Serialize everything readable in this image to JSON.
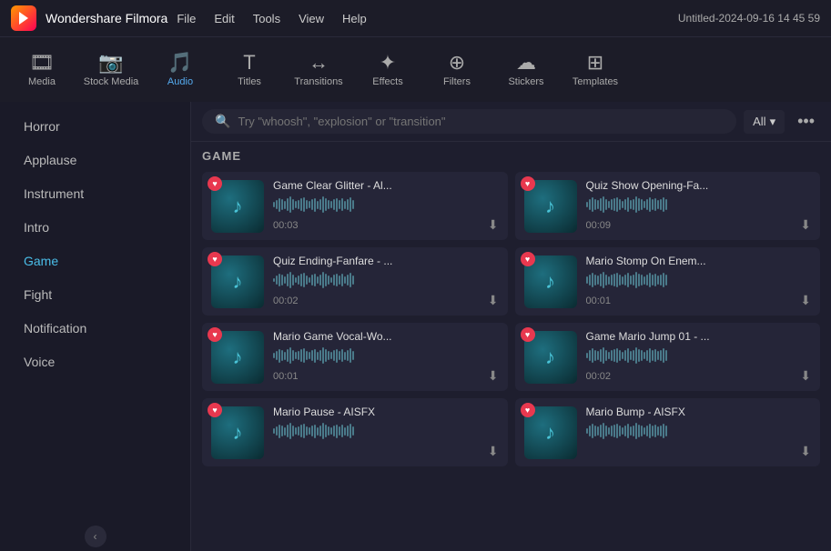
{
  "app": {
    "name": "Wondershare Filmora",
    "title": "Untitled-2024-09-16 14 45 59"
  },
  "menu": {
    "items": [
      "File",
      "Edit",
      "Tools",
      "View",
      "Help"
    ]
  },
  "toolbar": {
    "items": [
      {
        "id": "media",
        "icon": "🎞",
        "label": "Media",
        "active": false
      },
      {
        "id": "stock-media",
        "icon": "📷",
        "label": "Stock Media",
        "active": false
      },
      {
        "id": "audio",
        "icon": "🎵",
        "label": "Audio",
        "active": true
      },
      {
        "id": "titles",
        "icon": "T",
        "label": "Titles",
        "active": false
      },
      {
        "id": "transitions",
        "icon": "↔",
        "label": "Transitions",
        "active": false
      },
      {
        "id": "effects",
        "icon": "✦",
        "label": "Effects",
        "active": false
      },
      {
        "id": "filters",
        "icon": "⊕",
        "label": "Filters",
        "active": false
      },
      {
        "id": "stickers",
        "icon": "☁",
        "label": "Stickers",
        "active": false
      },
      {
        "id": "templates",
        "icon": "⊞",
        "label": "Templates",
        "active": false
      }
    ]
  },
  "sidebar": {
    "items": [
      {
        "label": "Horror",
        "active": false
      },
      {
        "label": "Applause",
        "active": false
      },
      {
        "label": "Instrument",
        "active": false
      },
      {
        "label": "Intro",
        "active": false
      },
      {
        "label": "Game",
        "active": true
      },
      {
        "label": "Fight",
        "active": false
      },
      {
        "label": "Notification",
        "active": false
      },
      {
        "label": "Voice",
        "active": false
      },
      {
        "label": "...",
        "active": false
      }
    ],
    "collapse_btn": "‹"
  },
  "search": {
    "placeholder": "Try \"whoosh\", \"explosion\" or \"transition\"",
    "filter_label": "All",
    "more_icon": "•••"
  },
  "section": {
    "title": "GAME"
  },
  "audio_cards": [
    {
      "name": "Game Clear Glitter - Al...",
      "duration": "00:03",
      "waveform_bars": [
        4,
        7,
        10,
        8,
        6,
        9,
        12,
        8,
        5,
        7,
        9,
        11,
        7,
        5,
        8,
        10,
        6,
        8,
        12,
        9,
        7,
        5,
        8,
        10,
        7,
        9,
        6,
        8,
        11,
        7
      ]
    },
    {
      "name": "Quiz Show Opening-Fa...",
      "duration": "00:09",
      "waveform_bars": [
        5,
        8,
        11,
        9,
        7,
        10,
        13,
        9,
        6,
        8,
        10,
        12,
        8,
        6,
        9,
        11,
        7,
        9,
        13,
        10,
        8,
        6,
        9,
        11,
        8,
        10,
        7,
        9,
        12,
        8
      ]
    },
    {
      "name": "Quiz Ending-Fanfare - ...",
      "duration": "00:02",
      "waveform_bars": [
        3,
        6,
        9,
        7,
        5,
        8,
        11,
        7,
        4,
        6,
        8,
        10,
        6,
        4,
        7,
        9,
        5,
        7,
        11,
        8,
        6,
        4,
        7,
        9,
        6,
        8,
        5,
        7,
        10,
        6
      ]
    },
    {
      "name": "Mario Stomp On Enem...",
      "duration": "00:01",
      "waveform_bars": [
        6,
        9,
        12,
        10,
        8,
        11,
        14,
        10,
        7,
        9,
        11,
        13,
        9,
        7,
        10,
        12,
        8,
        10,
        14,
        11,
        9,
        7,
        10,
        12,
        9,
        11,
        8,
        10,
        13,
        9
      ]
    },
    {
      "name": "Mario Game Vocal-Wo...",
      "duration": "00:01",
      "waveform_bars": [
        4,
        7,
        10,
        8,
        6,
        9,
        12,
        8,
        5,
        7,
        9,
        11,
        7,
        5,
        8,
        10,
        6,
        8,
        12,
        9,
        7,
        5,
        8,
        10,
        7,
        9,
        6,
        8,
        11,
        7
      ]
    },
    {
      "name": "Game Mario Jump 01 - ...",
      "duration": "00:02",
      "waveform_bars": [
        5,
        8,
        11,
        9,
        7,
        10,
        13,
        9,
        6,
        8,
        10,
        12,
        8,
        6,
        9,
        11,
        7,
        9,
        13,
        10,
        8,
        6,
        9,
        11,
        8,
        10,
        7,
        9,
        12,
        8
      ]
    },
    {
      "name": "Mario Pause - AISFX",
      "duration": "",
      "waveform_bars": [
        4,
        7,
        10,
        8,
        6,
        9,
        12,
        8,
        5,
        7,
        9,
        11,
        7,
        5,
        8,
        10,
        6,
        8,
        12,
        9,
        7,
        5,
        8,
        10,
        7,
        9,
        6,
        8,
        11,
        7
      ]
    },
    {
      "name": "Mario Bump - AISFX",
      "duration": "",
      "waveform_bars": [
        5,
        8,
        11,
        9,
        7,
        10,
        13,
        9,
        6,
        8,
        10,
        12,
        8,
        6,
        9,
        11,
        7,
        9,
        13,
        10,
        8,
        6,
        9,
        11,
        8,
        10,
        7,
        9,
        12,
        8
      ]
    }
  ]
}
